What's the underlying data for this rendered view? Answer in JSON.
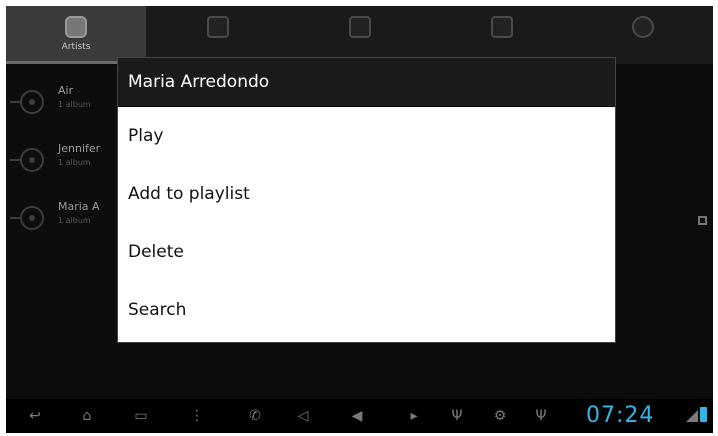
{
  "tabs": [
    {
      "label": "Artists",
      "icon": "microphone-icon",
      "active": true
    },
    {
      "label": "",
      "icon": "album-icon",
      "active": false
    },
    {
      "label": "",
      "icon": "songs-icon",
      "active": false
    },
    {
      "label": "",
      "icon": "playlist-icon",
      "active": false
    },
    {
      "label": "",
      "icon": "now-playing-icon",
      "active": false
    }
  ],
  "artists": [
    {
      "name": "Air",
      "sub": "1 album"
    },
    {
      "name": "Jennifer",
      "sub": "1 album"
    },
    {
      "name": "Maria A",
      "sub": "1 album"
    }
  ],
  "dialog": {
    "title": "Maria Arredondo",
    "items": [
      {
        "label": "Play"
      },
      {
        "label": "Add to playlist"
      },
      {
        "label": "Delete"
      },
      {
        "label": "Search"
      }
    ]
  },
  "status": {
    "time": "07:24"
  },
  "colors": {
    "accent": "#33b5e5",
    "background": "#0d0d0d",
    "dialog_title_bg": "#1b1b1b"
  }
}
